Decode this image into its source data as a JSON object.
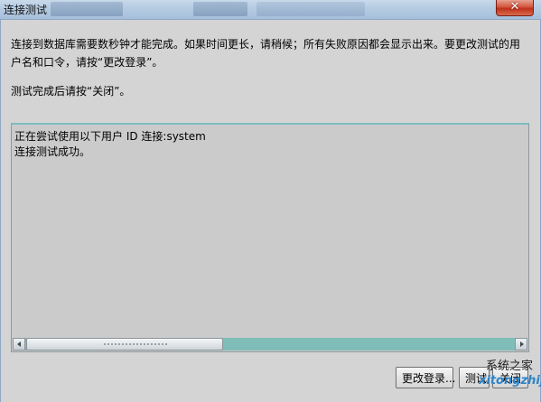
{
  "window": {
    "title": "连接测试",
    "close_glyph": "✕"
  },
  "info": {
    "paragraph1": "连接到数据库需要数秒钟才能完成。如果时间更长，请稍候；所有失败原因都会显示出来。要更改测试的用户名和口令，请按“更改登录”。",
    "paragraph2": "测试完成后请按“关闭”。"
  },
  "output": {
    "lines": [
      "正在尝试使用以下用户 ID 连接:system",
      "连接测试成功。"
    ]
  },
  "scrollbar": {
    "position": 0,
    "visible_fraction": 0.38
  },
  "buttons": {
    "change_login": "更改登录...",
    "test": "测试",
    "close": "关闭"
  },
  "watermark": {
    "text": "系统之家",
    "domain": "xitongzhijia"
  },
  "colors": {
    "titlebar": "#b5cbe2",
    "client_bg": "#d4d4d4",
    "scroll_track": "#7fbdb9",
    "close_button": "#c0301a"
  }
}
